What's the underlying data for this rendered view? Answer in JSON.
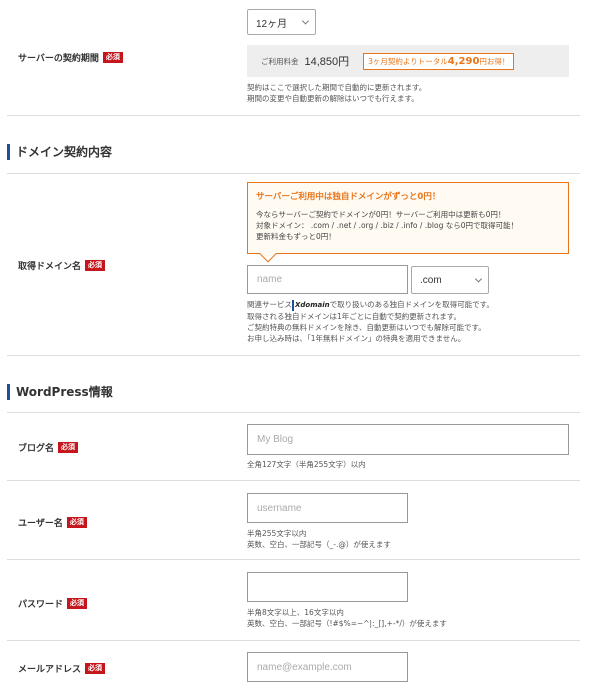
{
  "contract": {
    "period_select": "12ヶ月",
    "label": "サーバーの契約期間",
    "required": "必須",
    "price_label": "ご利用料金",
    "price_value": "14,850円",
    "discount_prefix": "3ヶ月契約よりトータル",
    "discount_amount": "4,290",
    "discount_suffix": "円お得！",
    "notes": [
      "契約はここで選択した期間で自動的に更新されます。",
      "期間の変更や自動更新の解除はいつでも行えます。"
    ]
  },
  "domain_section": {
    "title": "ドメイン契約内容",
    "label": "取得ドメイン名",
    "required": "必須",
    "promo_title": "サーバーご利用中は独自ドメインがずっと0円！",
    "promo_lines": [
      "今ならサーバーご契約でドメインが0円！サーバーご利用中は更新も0円！",
      "対象ドメイン： .com / .net / .org / .biz / .info / .blog なら0円で取得可能！",
      "更新料金もずっと0円！"
    ],
    "name_placeholder": "name",
    "tld_select": ".com",
    "notes_prefix": "関連サービス",
    "xdomain_logo": "Xdomain",
    "notes_suffix": "で取り扱いのある独自ドメインを取得可能です。",
    "notes": [
      "取得される独自ドメインは1年ごとに自動で契約更新されます。",
      "ご契約特典の無料ドメインを除き、自動更新はいつでも解除可能です。",
      "お申し込み時は、「1年無料ドメイン」の特典を適用できません。"
    ]
  },
  "wp_section": {
    "title": "WordPress情報",
    "blog": {
      "label": "ブログ名",
      "required": "必須",
      "placeholder": "My Blog",
      "note": "全角127文字（半角255文字）以内"
    },
    "user": {
      "label": "ユーザー名",
      "required": "必須",
      "placeholder": "username",
      "notes": [
        "半角255文字以内",
        "英数、空白、一部記号（_-.@）が使えます"
      ]
    },
    "password": {
      "label": "パスワード",
      "required": "必須",
      "placeholder": "",
      "notes": [
        "半角8文字以上、16文字以内",
        "英数、空白、一部記号（!#$%=~^|:_[],+-*/）が使えます"
      ]
    },
    "email": {
      "label": "メールアドレス",
      "required": "必須",
      "placeholder": "name@example.com"
    }
  },
  "colors": {
    "required_badge": "#c4161c",
    "accent_orange": "#e8751a",
    "section_bar": "#1f4e9c"
  }
}
